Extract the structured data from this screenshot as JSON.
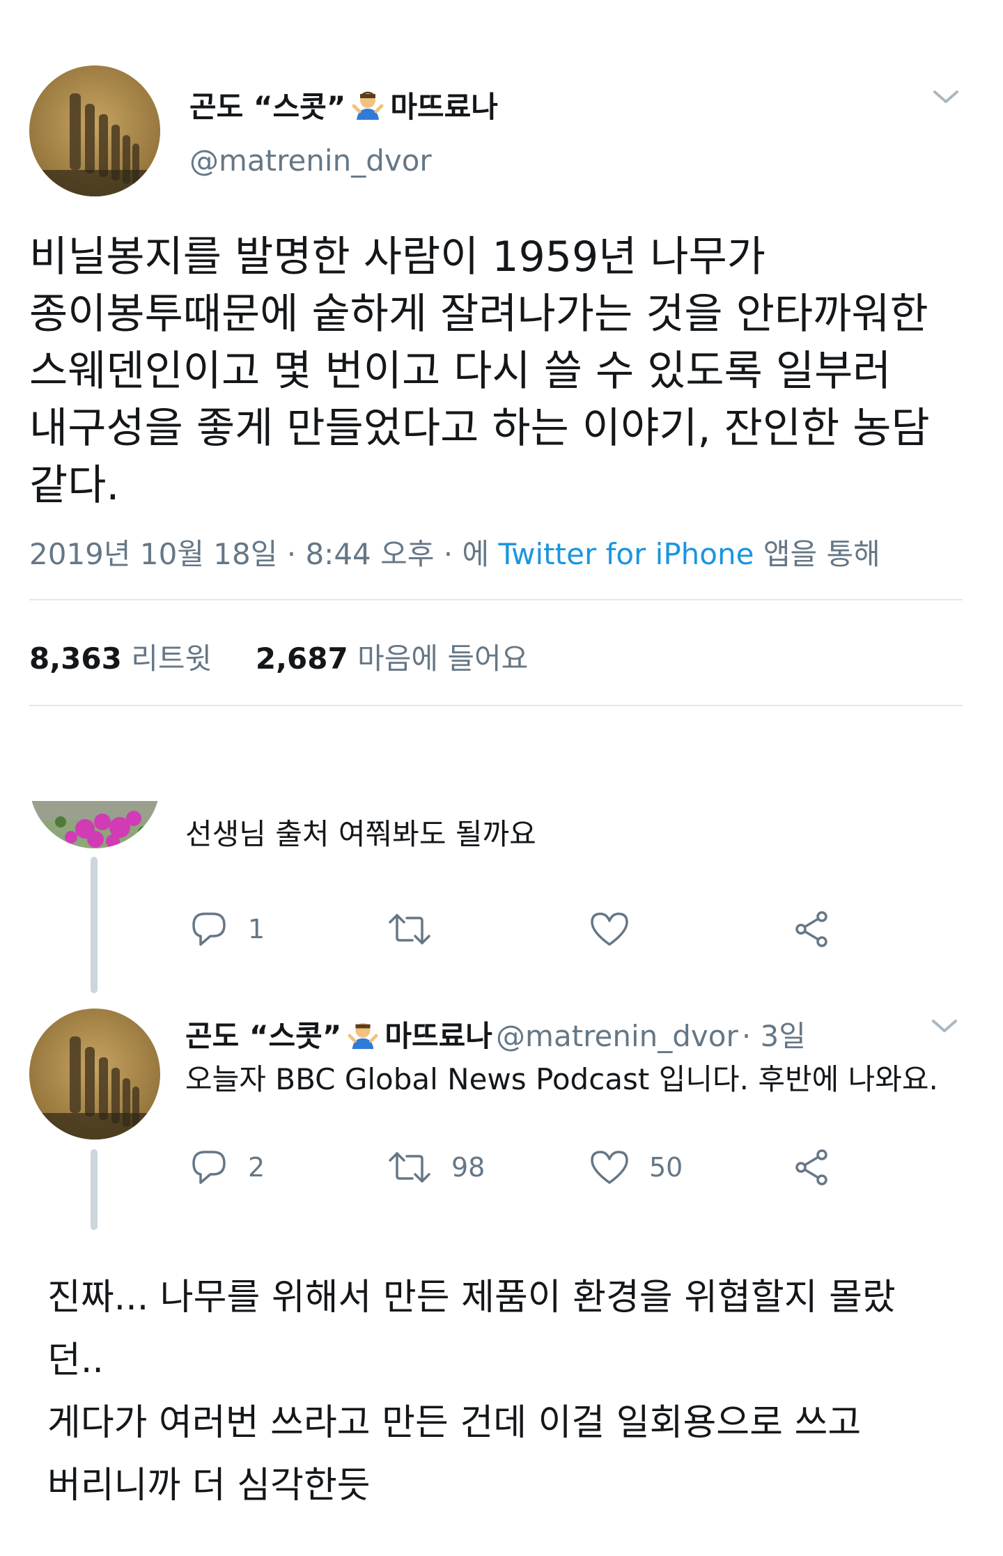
{
  "main_tweet": {
    "display_name_prefix": "곤도 “스콧”",
    "display_name_suffix": "마뜨료나",
    "handle": "@matrenin_dvor",
    "text": "비닐봉지를 발명한 사람이 1959년 나무가\n종이봉투때문에 숱하게 잘려나가는 것을 안타까워한\n스웨덴인이고 몇 번이고 다시 쓸 수 있도록 일부러\n내구성을 좋게 만들었다고 하는 이야기, 잔인한 농담\n같다.",
    "timestamp": "2019년 10월 18일 · 8:44 오후 · 에",
    "source": "Twitter for iPhone",
    "source_suffix": "앱을 통해",
    "retweets_count": "8,363",
    "retweets_label": "리트윗",
    "likes_count": "2,687",
    "likes_label": "마음에 들어요"
  },
  "reply1": {
    "text": "선생님 출처 여쭤봐도 될까요",
    "reply_count": "1"
  },
  "reply2": {
    "display_name_prefix": "곤도 “스콧”",
    "display_name_suffix": "마뜨료나",
    "handle": "@matrenin_dvor",
    "age": "· 3일",
    "text": "오늘자 BBC Global News Podcast 입니다. 후반에 나와요.",
    "reply_count": "2",
    "retweet_count": "98",
    "like_count": "50"
  },
  "comment": {
    "text": "진짜... 나무를 위해서 만든 제품이 환경을 위협할지 몰랐\n던..\n게다가 여러번 쓰라고 만든 건데 이걸 일회용으로 쓰고\n버리니까 더 심각한듯"
  },
  "colors": {
    "text": "#14171a",
    "secondary": "#657786",
    "link": "#1b95e0",
    "divider": "#e1e8ed",
    "thread_line": "#ccd6dd"
  },
  "icons": [
    "shrug-emoji",
    "chevron-down-icon",
    "reply-icon",
    "retweet-icon",
    "like-icon",
    "share-icon"
  ]
}
